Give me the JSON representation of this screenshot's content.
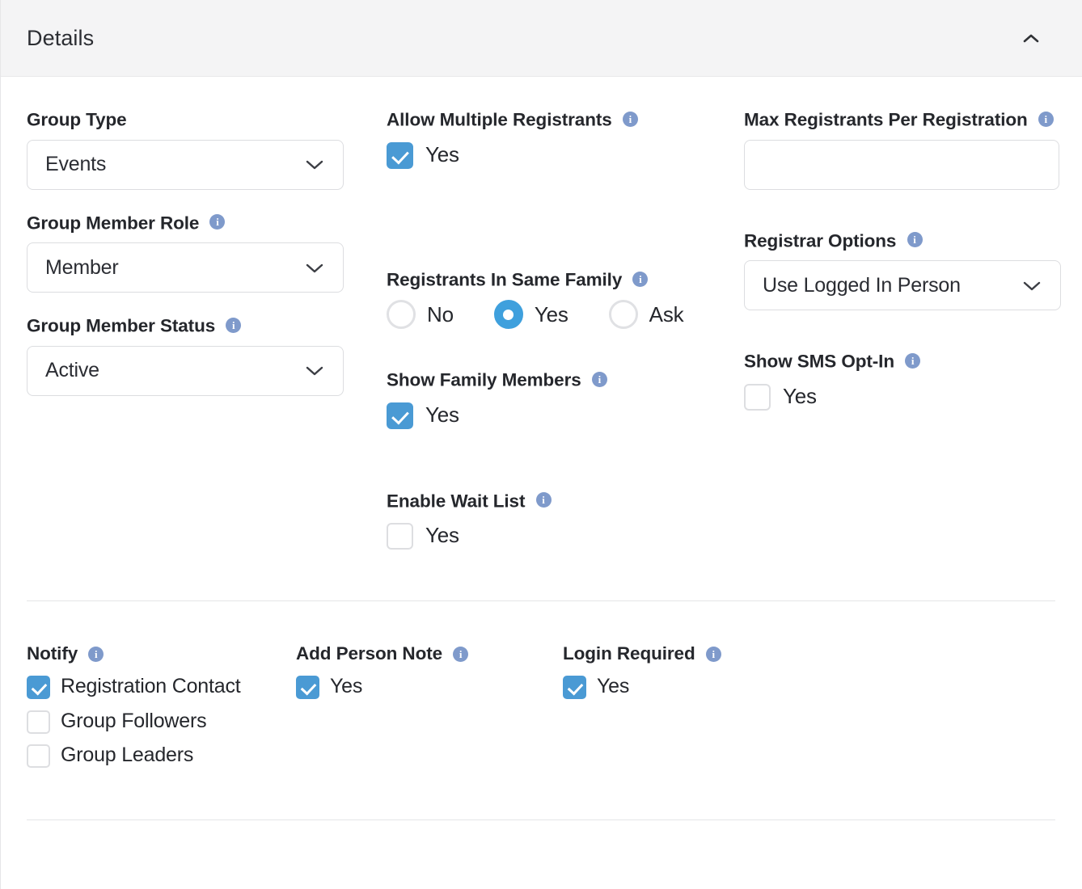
{
  "panel": {
    "title": "Details",
    "collapse_icon": "chevron-up-icon",
    "collapsed": false
  },
  "icons": {
    "info": "info-icon",
    "chevron_down": "chevron-down-icon",
    "chevron_up": "chevron-up-icon",
    "checkmark": "check-icon"
  },
  "colors": {
    "header_bg": "#f4f4f5",
    "accent_checked": "#4a9ad4",
    "accent_radio": "#3fa0dd",
    "info_icon": "#7f9acb",
    "border": "#dcdde0",
    "text": "#25272c",
    "divider": "#e4e5e7"
  },
  "left_column": {
    "group_type": {
      "label": "Group Type",
      "has_info": false,
      "value": "Events",
      "control": "select"
    },
    "group_member_role": {
      "label": "Group Member Role",
      "has_info": true,
      "value": "Member",
      "control": "select"
    },
    "group_member_status": {
      "label": "Group Member Status",
      "has_info": true,
      "value": "Active",
      "control": "select"
    }
  },
  "middle_column": {
    "allow_multiple_registrants": {
      "label": "Allow Multiple Registrants",
      "has_info": true,
      "checkbox_label": "Yes",
      "checked": true
    },
    "registrants_in_same_family": {
      "label": "Registrants In Same Family",
      "has_info": true,
      "options": [
        "No",
        "Yes",
        "Ask"
      ],
      "selected": "Yes"
    },
    "show_family_members": {
      "label": "Show Family Members",
      "has_info": true,
      "checkbox_label": "Yes",
      "checked": true
    },
    "enable_wait_list": {
      "label": "Enable Wait List",
      "has_info": true,
      "checkbox_label": "Yes",
      "checked": false
    }
  },
  "right_column": {
    "max_registrants": {
      "label": "Max Registrants Per Registration",
      "has_info": true,
      "value": "",
      "placeholder": "",
      "control": "text"
    },
    "registrar_options": {
      "label": "Registrar Options",
      "has_info": true,
      "value": "Use Logged In Person",
      "control": "select"
    },
    "show_sms_opt_in": {
      "label": "Show SMS Opt-In",
      "has_info": true,
      "checkbox_label": "Yes",
      "checked": false
    }
  },
  "bottom_section": {
    "notify": {
      "label": "Notify",
      "has_info": true,
      "options": [
        {
          "label": "Registration Contact",
          "checked": true
        },
        {
          "label": "Group Followers",
          "checked": false
        },
        {
          "label": "Group Leaders",
          "checked": false
        }
      ]
    },
    "add_person_note": {
      "label": "Add Person Note",
      "has_info": true,
      "checkbox_label": "Yes",
      "checked": true
    },
    "login_required": {
      "label": "Login Required",
      "has_info": true,
      "checkbox_label": "Yes",
      "checked": true
    }
  }
}
